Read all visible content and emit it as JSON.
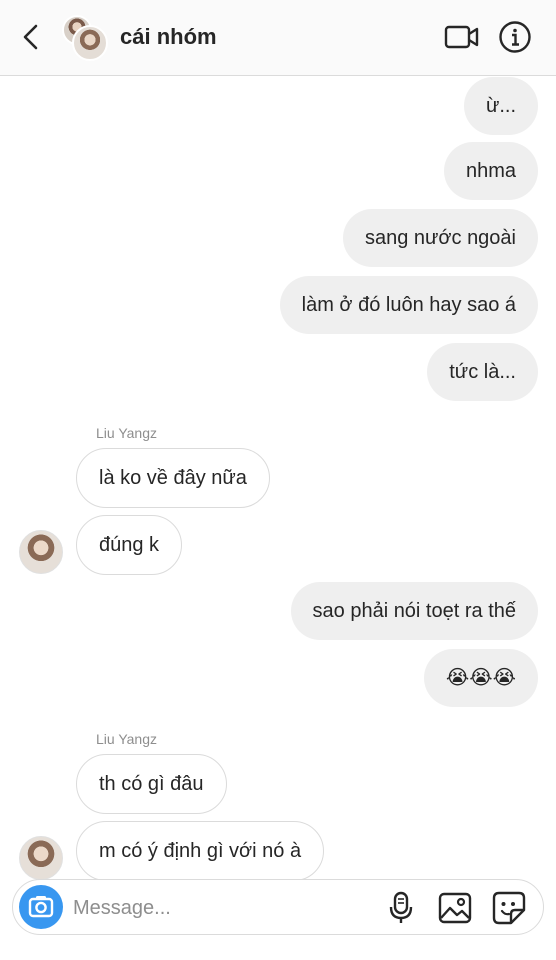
{
  "header": {
    "title": "cái nhóm"
  },
  "messages": [
    {
      "text": "ừ..."
    },
    {
      "text": "nhma"
    },
    {
      "text": "sang nước ngoài"
    },
    {
      "text": "làm ở đó luôn hay sao á"
    },
    {
      "text": "tức là..."
    },
    {
      "sender": "Liu Yangz"
    },
    {
      "text": "là ko về đây nữa"
    },
    {
      "text": "đúng k"
    },
    {
      "text": "sao phải nói toẹt ra thế"
    },
    {
      "text": "😭😭😭"
    },
    {
      "sender": "Liu Yangz"
    },
    {
      "text": "th có gì đâu"
    },
    {
      "text": "m có ý định gì với nó à"
    }
  ],
  "composer": {
    "placeholder": "Message..."
  },
  "colors": {
    "bubble_out": "#efefef",
    "bubble_in_border": "#dbdbdb",
    "camera_button": "#3897f0",
    "header_bg": "#fafafa"
  },
  "icons": [
    "back-chevron-icon",
    "video-call-icon",
    "info-icon",
    "camera-icon",
    "microphone-icon",
    "gallery-icon",
    "sticker-icon"
  ]
}
